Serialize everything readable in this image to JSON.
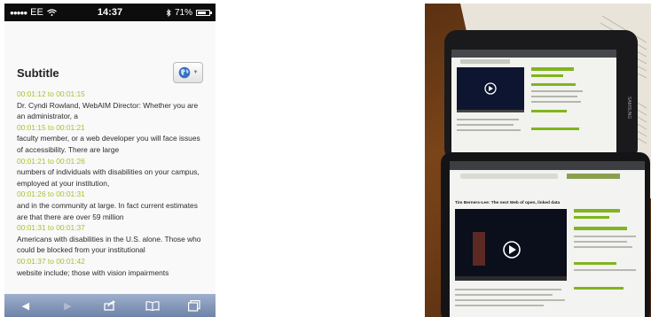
{
  "status_bar": {
    "carrier": "EE",
    "time": "14:37",
    "battery": "71%",
    "battery_level": 0.71
  },
  "page": {
    "title": "Subtitle"
  },
  "transcript": [
    {
      "time": "00:01:12 to 00:01:15",
      "text": "Dr. Cyndi Rowland, WebAIM Director: Whether you are an administrator, a"
    },
    {
      "time": "00:01:15 to 00:01:21",
      "text": "faculty member, or a web developer you will face issues of accessibility. There are large"
    },
    {
      "time": "00:01:21 to 00:01:26",
      "text": "numbers of individuals with disabilities on your campus, employed at your institution,"
    },
    {
      "time": "00:01:26 to 00:01:31",
      "text": "and in the community at large. In fact current estimates are that there are over 59 million"
    },
    {
      "time": "00:01:31 to 00:01:37",
      "text": "Americans with disabilities in the U.S. alone. Those who could be blocked from your institutional"
    },
    {
      "time": "00:01:37 to 00:01:42",
      "text": "website include; those with vision impairments"
    }
  ],
  "toolbar_icons": [
    "back-arrow-icon",
    "forward-arrow-icon",
    "share-icon",
    "bookmarks-icon",
    "tabs-icon"
  ],
  "photo": {
    "video_title": "Tim Berners-Lee: The next Web of open, linked data",
    "brand": "SAMSUNG",
    "accent": "#7fb51e"
  }
}
